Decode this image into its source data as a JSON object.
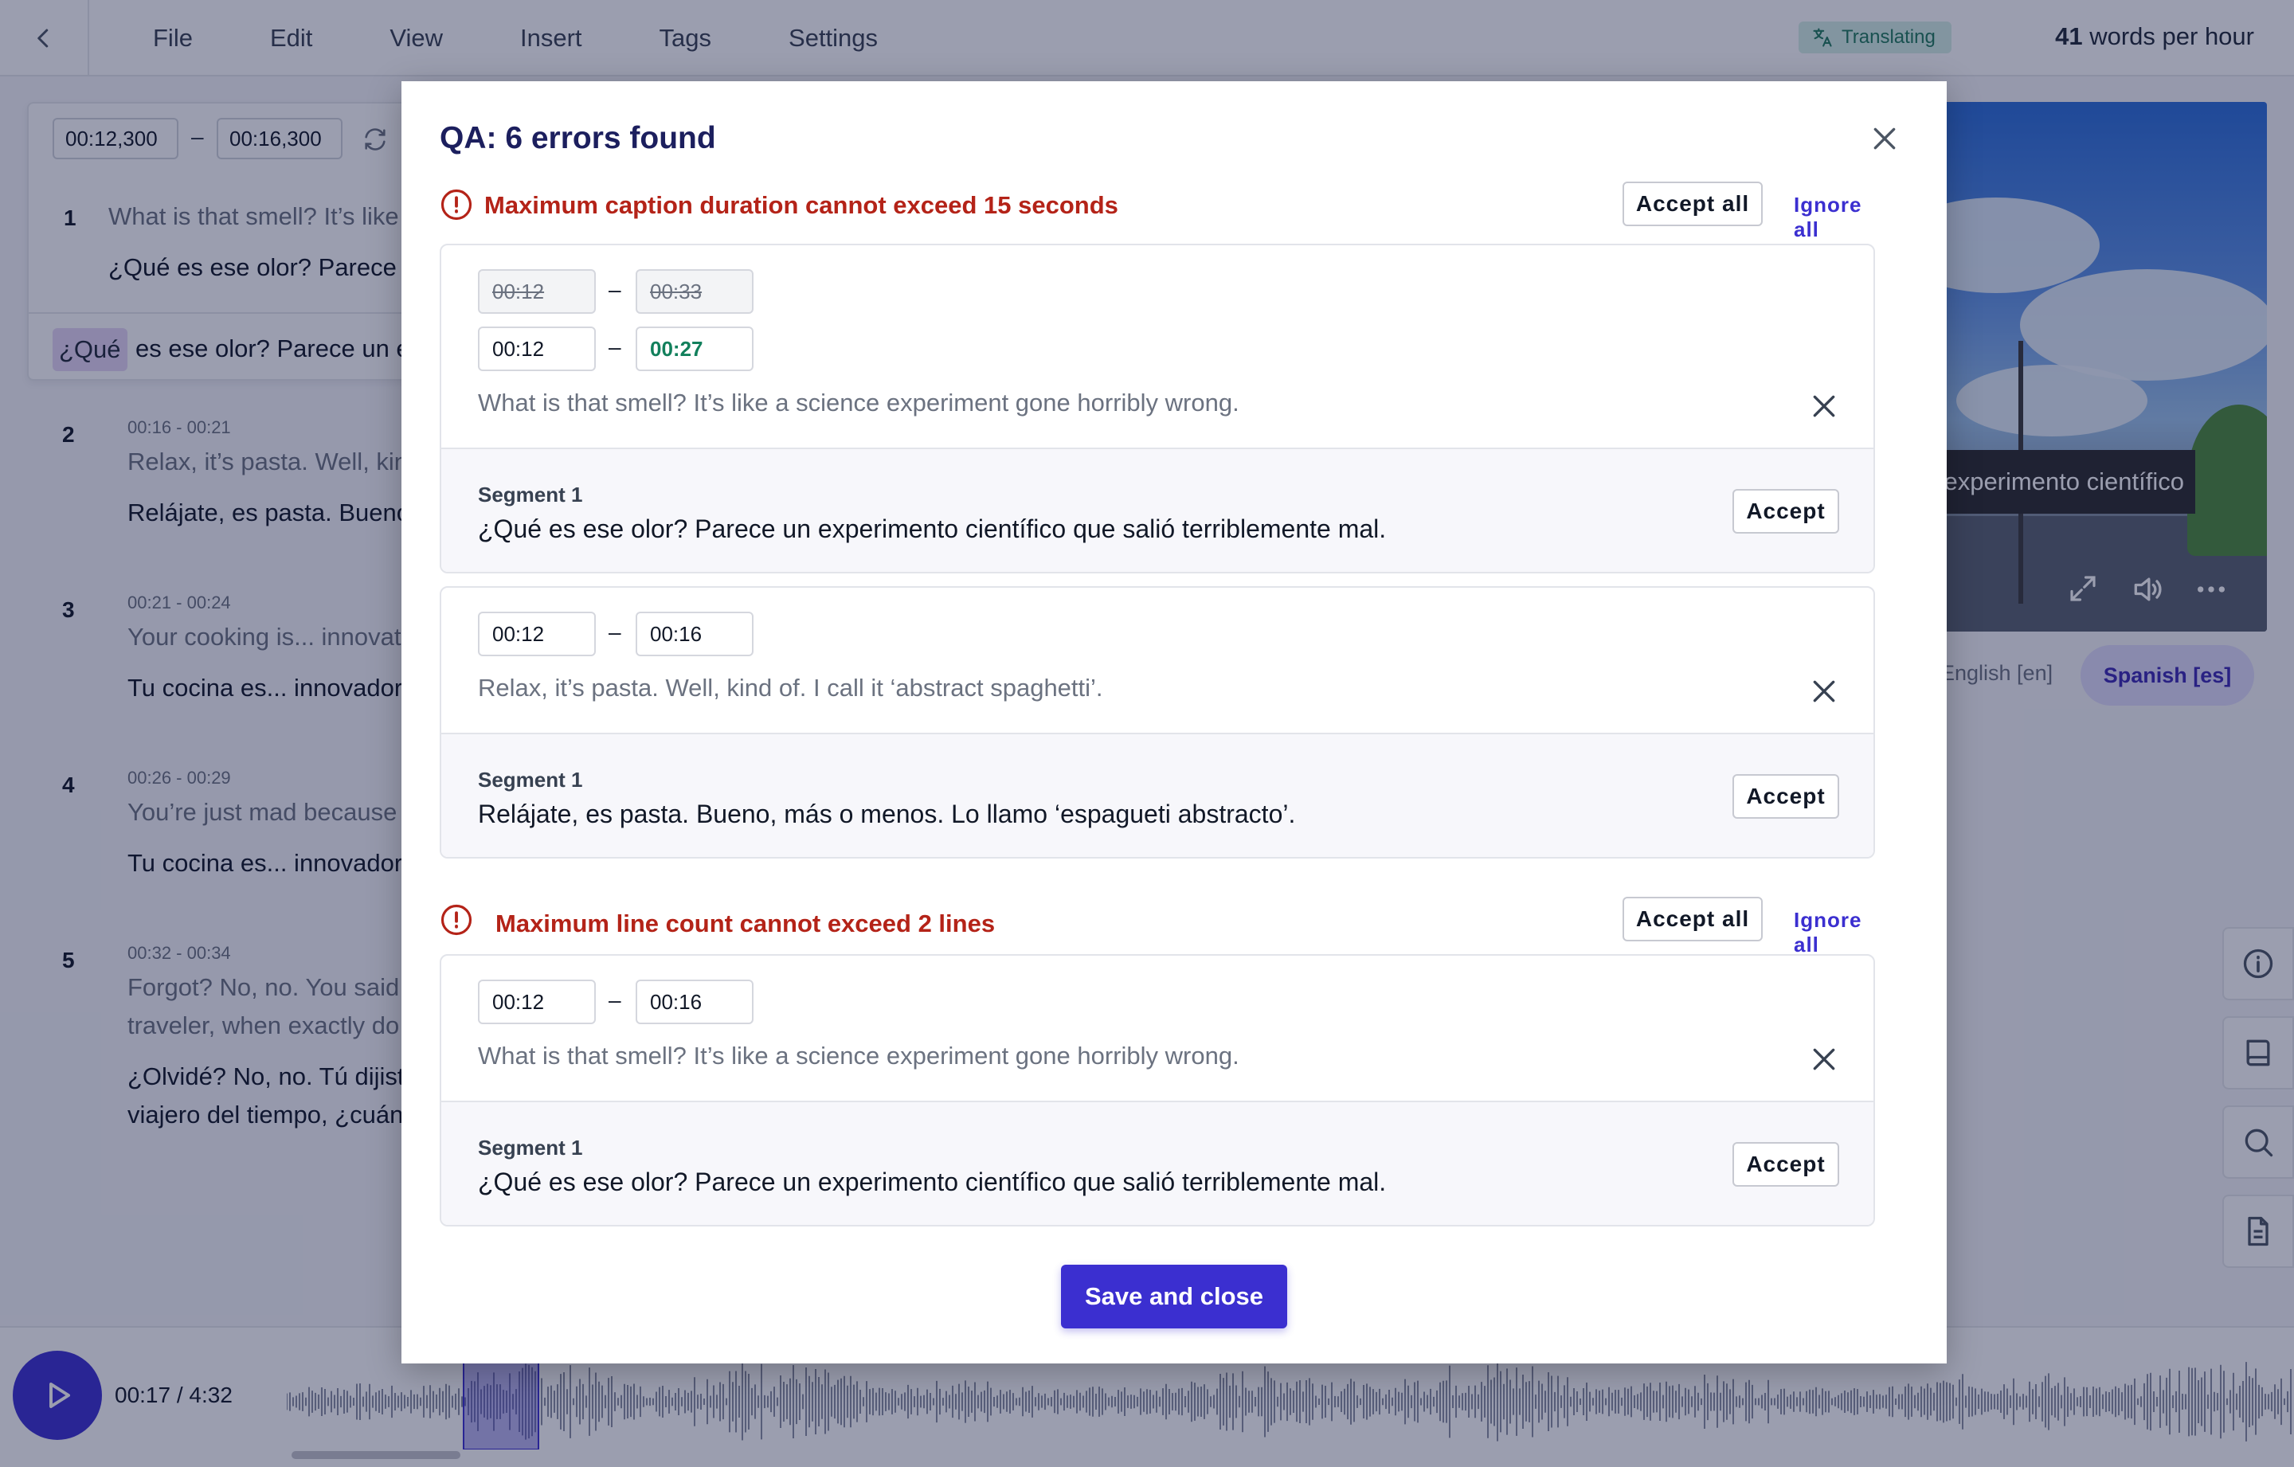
{
  "menu": {
    "back_icon": "chevron-left-icon",
    "items": [
      "File",
      "Edit",
      "View",
      "Insert",
      "Tags",
      "Settings"
    ]
  },
  "status": {
    "translating": "Translating",
    "words_count": "41",
    "words_suffix": " words per hour"
  },
  "editor": {
    "active": {
      "start": "00:12,300",
      "dash": "–",
      "end": "00:16,300",
      "num": "1",
      "en": "What is that smell? It’s like a science experiment gone horribly wrong.",
      "es": "¿Qué es ese olor? Parece un experimento científico que salió terriblemente mal.",
      "highlight": "¿Qué",
      "es_rest": "es ese olor? Parece un experimento científico que salió terriblemente mal."
    },
    "segments": [
      {
        "num": "2",
        "time": "00:16 - 00:21",
        "en": "Relax, it’s pasta. Well, kind of. I call it ‘abstract spaghetti’.",
        "es": "Relájate, es pasta. Bueno, más o menos. Lo llamo ‘espagueti abstracto’."
      },
      {
        "num": "3",
        "time": "00:21 - 00:24",
        "en": "Your cooking is... innovative.",
        "es": "Tu cocina es... innovadora."
      },
      {
        "num": "4",
        "time": "00:26 - 00:29",
        "en": "You’re just mad because I forgot.",
        "es": "Tu cocina es... innovadora."
      },
      {
        "num": "5",
        "time": "00:32 - 00:34",
        "en": "Forgot? No, no. You said you were a time",
        "en2": "traveler, when exactly do you think you are?",
        "es": "¿Olvidé? No, no. Tú dijiste que eras un",
        "es2": "viajero del tiempo, ¿cuándo crees que estás?"
      }
    ]
  },
  "video": {
    "caption": "¿Qué es ese olor? Parece un experimento científico",
    "lang_en": "English [en]",
    "lang_es": "Spanish [es]"
  },
  "playback": {
    "time": "00:17 / 4:32"
  },
  "modal": {
    "title": "QA: 6 errors found",
    "accept_all": "Accept all",
    "ignore_all": "Ignore all",
    "accept": "Accept",
    "save": "Save and close",
    "groups": [
      {
        "error": "Maximum caption duration cannot exceed 15 seconds",
        "items": [
          {
            "old_start": "00:12",
            "old_end": "00:33",
            "start": "00:12",
            "end": "00:27",
            "dash": "–",
            "source": "What is that smell? It’s like a science experiment gone horribly wrong.",
            "segment_label": "Segment 1",
            "translation": "¿Qué es ese olor? Parece un experimento científico que salió terriblemente mal."
          },
          {
            "start": "00:12",
            "end": "00:16",
            "dash": "–",
            "source": "Relax, it’s pasta. Well, kind of. I call it ‘abstract spaghetti’.",
            "segment_label": "Segment 1",
            "translation": "Relájate, es pasta. Bueno, más o menos. Lo llamo ‘espagueti abstracto’."
          }
        ]
      },
      {
        "error": "Maximum line count cannot exceed 2 lines",
        "items": [
          {
            "start": "00:12",
            "end": "00:16",
            "dash": "–",
            "source": "What is that smell? It’s like a science experiment gone horribly wrong.",
            "segment_label": "Segment 1",
            "translation": "¿Qué es ese olor? Parece un experimento científico que salió terriblemente mal."
          }
        ]
      }
    ]
  }
}
